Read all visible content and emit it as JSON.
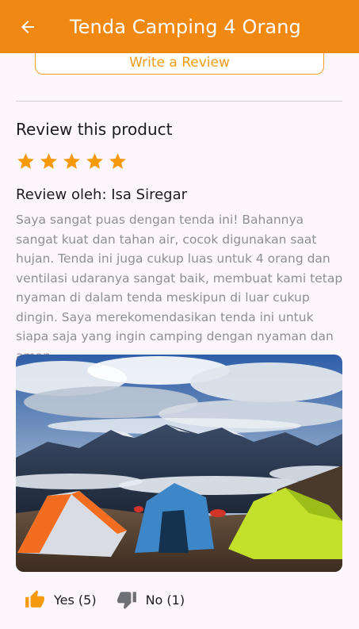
{
  "app_bar": {
    "title": "Tenda Camping 4 Orang",
    "back_icon": "arrow-left-icon",
    "color": "#f08812"
  },
  "write_review": {
    "label": "Write a Review"
  },
  "review_section": {
    "title": "Review this product",
    "rating": 5,
    "max_rating": 5,
    "star_color": "#f59a0c",
    "reviewer_label": "Review oleh: Isa Siregar",
    "text": "Saya sangat puas dengan tenda ini! Bahannya sangat kuat dan tahan air, cocok digunakan saat hujan. Tenda ini juga cukup luas untuk 4 orang dan ventilasi udaranya sangat baik, membuat kami tetap nyaman di dalam tenda meskipun di luar cukup dingin. Saya merekomendasikan tenda ini untuk siapa saja yang ingin camping dengan nyaman dan aman."
  },
  "helpful": {
    "yes_label": "Yes (5)",
    "no_label": "No (1)",
    "yes_icon": "thumbs-up-icon",
    "no_icon": "thumbs-down-icon"
  }
}
